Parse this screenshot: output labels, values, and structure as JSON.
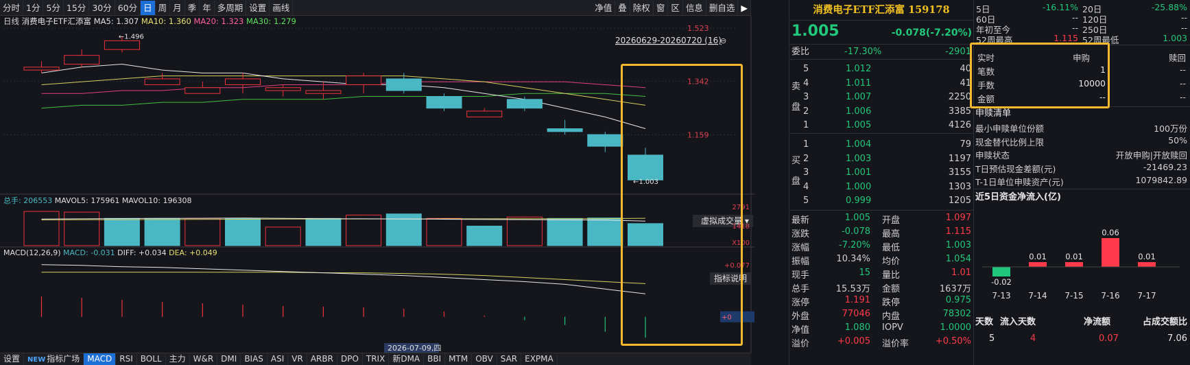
{
  "toolbar": {
    "periods": [
      "分时",
      "1分",
      "5分",
      "15分",
      "30分",
      "60分",
      "日",
      "周",
      "月",
      "季",
      "年",
      "多周期",
      "设置",
      "画线"
    ],
    "active_period": "日",
    "right_buttons": [
      "净值",
      "叠",
      "除权",
      "窗",
      "区",
      "信息",
      "删自选"
    ]
  },
  "kline_header": {
    "period": "日线",
    "name": "消费电子ETF汇添富",
    "ma5": "MA5: 1.307",
    "ma10": "MA10: 1.360",
    "ma20": "MA20: 1.323",
    "ma30": "MA30: 1.279",
    "range_label": "20260629-20260720 (16)",
    "price_axis": [
      "1.523",
      "1.342",
      "1.159"
    ],
    "high_note": "←1.496",
    "low_note": "←1.003"
  },
  "volume_header": {
    "total": "总手: 206553",
    "mavol5": "MAVOL5: 175961",
    "mavol10": "MAVOL10: 196308",
    "virtual_btn": "虚拟成交量",
    "axis": [
      "2791",
      "1418",
      "X100"
    ]
  },
  "macd_header": {
    "label": "MACD(12,26,9)",
    "macd": "MACD: -0.031",
    "diff": "DIFF: +0.034",
    "dea": "DEA: +0.049",
    "explain_btn": "指标说明",
    "axis_top": "+0.077",
    "axis_zero": "+0"
  },
  "date_marker": "2026-07-09,四",
  "chart_data": [
    {
      "type": "candlestick",
      "title": "消费电子ETF汇添富 日线",
      "x": [
        "2026-06-29",
        "2026-06-30",
        "2026-07-01",
        "2026-07-02",
        "2026-07-03",
        "2026-07-06",
        "2026-07-07",
        "2026-07-08",
        "2026-07-09",
        "2026-07-10",
        "2026-07-13",
        "2026-07-14",
        "2026-07-15",
        "2026-07-16",
        "2026-07-17",
        "2026-07-20"
      ],
      "open": [
        1.38,
        1.4,
        1.45,
        1.33,
        1.3,
        1.33,
        1.31,
        1.3,
        1.33,
        1.35,
        1.29,
        1.22,
        1.28,
        1.18,
        1.16,
        1.09
      ],
      "close": [
        1.39,
        1.43,
        1.48,
        1.35,
        1.32,
        1.35,
        1.32,
        1.31,
        1.36,
        1.31,
        1.25,
        1.24,
        1.25,
        1.17,
        1.12,
        1.005
      ],
      "high": [
        1.41,
        1.45,
        1.496,
        1.37,
        1.34,
        1.37,
        1.33,
        1.34,
        1.37,
        1.37,
        1.3,
        1.25,
        1.29,
        1.21,
        1.17,
        1.115
      ],
      "low": [
        1.37,
        1.39,
        1.44,
        1.33,
        1.3,
        1.3,
        1.29,
        1.28,
        1.3,
        1.3,
        1.24,
        1.22,
        1.24,
        1.16,
        1.1,
        1.003
      ],
      "ma5": [
        1.37,
        1.39,
        1.4,
        1.38,
        1.37,
        1.37,
        1.35,
        1.34,
        1.33,
        1.33,
        1.32,
        1.3,
        1.28,
        1.25,
        1.22,
        1.18
      ],
      "ma10": [
        1.33,
        1.34,
        1.35,
        1.36,
        1.36,
        1.36,
        1.36,
        1.36,
        1.36,
        1.36,
        1.35,
        1.34,
        1.32,
        1.3,
        1.28,
        1.26
      ],
      "ma20": [
        1.3,
        1.3,
        1.31,
        1.31,
        1.32,
        1.32,
        1.33,
        1.33,
        1.33,
        1.34,
        1.34,
        1.34,
        1.34,
        1.34,
        1.33,
        1.32
      ],
      "ma30": [
        1.25,
        1.26,
        1.26,
        1.27,
        1.27,
        1.28,
        1.28,
        1.28,
        1.29,
        1.29,
        1.29,
        1.29,
        1.3,
        1.3,
        1.3,
        1.29
      ],
      "ylim": [
        0.98,
        1.53
      ]
    },
    {
      "type": "bar",
      "title": "volume",
      "values": [
        2450,
        2400,
        1950,
        1950,
        1950,
        1950,
        1330,
        1950,
        2190,
        2270,
        1950,
        1400,
        2050,
        1950,
        1980,
        1580
      ],
      "up": [
        true,
        true,
        false,
        false,
        true,
        false,
        true,
        false,
        true,
        false,
        true,
        false,
        true,
        false,
        false,
        false
      ],
      "mavol5": [
        1900,
        1920,
        1940,
        1950,
        1960,
        1980,
        1950,
        1930,
        1920,
        1910,
        1890,
        1870,
        1860,
        1840,
        1830,
        1760
      ],
      "mavol10": [
        1840,
        1850,
        1860,
        1870,
        1880,
        1890,
        1900,
        1900,
        1910,
        1910,
        1920,
        1920,
        1920,
        1930,
        1930,
        1960
      ],
      "ylim": [
        0,
        2800
      ]
    },
    {
      "type": "bar",
      "title": "MACD",
      "values": [
        0.03,
        0.028,
        0.025,
        0.022,
        0.02,
        0.018,
        0.016,
        0.015,
        0.014,
        0.012,
        0.008,
        0.002,
        -0.005,
        -0.012,
        -0.022,
        -0.031
      ],
      "diff": [
        0.077,
        0.076,
        0.074,
        0.073,
        0.071,
        0.069,
        0.067,
        0.065,
        0.063,
        0.061,
        0.058,
        0.055,
        0.052,
        0.048,
        0.041,
        0.034
      ],
      "dea": [
        0.066,
        0.066,
        0.066,
        0.066,
        0.066,
        0.066,
        0.066,
        0.065,
        0.065,
        0.064,
        0.063,
        0.061,
        0.058,
        0.055,
        0.052,
        0.049
      ],
      "ylim": [
        -0.05,
        0.09
      ]
    }
  ],
  "bottom_tabs": [
    "设置",
    "指标广场",
    "MACD",
    "RSI",
    "BOLL",
    "主力",
    "W&R",
    "DMI",
    "BIAS",
    "ASI",
    "VR",
    "ARBR",
    "DPO",
    "TRIX",
    "新DMA",
    "BBI",
    "MTM",
    "OBV",
    "SAR",
    "EXPMA"
  ],
  "bottom_new_tag": "NEW",
  "bottom_active": "MACD",
  "quote": {
    "title": "消费电子ETF汇添富 159178",
    "price": "1.005",
    "change": "-0.078(-7.20%)",
    "weibi_label": "委比",
    "weibi_val": "-17.30%",
    "weibi_diff": "-2901",
    "sell_label": [
      "卖",
      "盘"
    ],
    "buy_label": [
      "买",
      "盘"
    ],
    "asks": [
      {
        "lvl": "5",
        "price": "1.012",
        "vol": "40"
      },
      {
        "lvl": "4",
        "price": "1.011",
        "vol": "41"
      },
      {
        "lvl": "3",
        "price": "1.007",
        "vol": "2250"
      },
      {
        "lvl": "2",
        "price": "1.006",
        "vol": "3385"
      },
      {
        "lvl": "1",
        "price": "1.005",
        "vol": "4126"
      }
    ],
    "bids": [
      {
        "lvl": "1",
        "price": "1.004",
        "vol": "79"
      },
      {
        "lvl": "2",
        "price": "1.003",
        "vol": "1197"
      },
      {
        "lvl": "3",
        "price": "1.001",
        "vol": "3155"
      },
      {
        "lvl": "4",
        "price": "1.000",
        "vol": "1303"
      },
      {
        "lvl": "5",
        "price": "0.999",
        "vol": "1205"
      }
    ],
    "stats": [
      {
        "l1": "最新",
        "v1": "1.005",
        "c1": "green",
        "l2": "开盘",
        "v2": "1.097",
        "c2": "red"
      },
      {
        "l1": "涨跌",
        "v1": "-0.078",
        "c1": "green",
        "l2": "最高",
        "v2": "1.115",
        "c2": "red"
      },
      {
        "l1": "涨幅",
        "v1": "-7.20%",
        "c1": "green",
        "l2": "最低",
        "v2": "1.003",
        "c2": "green"
      },
      {
        "l1": "振幅",
        "v1": "10.34%",
        "c1": "gray",
        "l2": "均价",
        "v2": "1.054",
        "c2": "green"
      },
      {
        "l1": "现手",
        "v1": "15",
        "c1": "green",
        "l2": "量比",
        "v2": "1.01",
        "c2": "red"
      },
      {
        "l1": "总手",
        "v1": "15.53万",
        "c1": "gray",
        "l2": "金额",
        "v2": "1637万",
        "c2": "gray"
      },
      {
        "l1": "涨停",
        "v1": "1.191",
        "c1": "red",
        "l2": "跌停",
        "v2": "0.975",
        "c2": "green"
      },
      {
        "l1": "外盘",
        "v1": "77046",
        "c1": "red",
        "l2": "内盘",
        "v2": "78302",
        "c2": "green"
      },
      {
        "l1": "净值",
        "v1": "1.080",
        "c1": "green",
        "l2": "IOPV",
        "v2": "1.0000",
        "c2": "green"
      },
      {
        "l1": "溢价",
        "v1": "+0.005",
        "c1": "red",
        "l2": "溢价率",
        "v2": "+0.50%",
        "c2": "red"
      }
    ]
  },
  "etf": {
    "perf": [
      {
        "l1": "5日",
        "v1": "-16.11%",
        "l2": "20日",
        "v2": "-25.88%"
      },
      {
        "l1": "60日",
        "v1": "-- ",
        "l2": "120日",
        "v2": "--"
      },
      {
        "l1": "年初至今",
        "v1": "-- ",
        "l2": "250日",
        "v2": "--"
      },
      {
        "l1": "52周最高",
        "v1": "1.115",
        "l2": "52周最低",
        "v2": "1.003"
      }
    ],
    "sub_header": {
      "c1": "实时",
      "c2": "申购",
      "c3": "赎回"
    },
    "sub_rows": [
      {
        "l": "笔数",
        "v": "1",
        "r": "--"
      },
      {
        "l": "手数",
        "v": "10000",
        "r": "--"
      },
      {
        "l": "金额",
        "v": "--",
        "r": "--"
      }
    ],
    "list_title": "申赎清单",
    "list": [
      {
        "l": "最小申赎单位份额",
        "v": "100万份"
      },
      {
        "l": "现金替代比例上限",
        "v": "50%"
      },
      {
        "l": "申赎状态",
        "v": "开放申购|开放赎回"
      },
      {
        "l": "T日预估现金差额(元)",
        "v": "-21469.23"
      },
      {
        "l": "T-1日单位申赎资产(元)",
        "v": "1079842.89"
      }
    ],
    "flow_title": "近5日资金净流入(亿)",
    "flow_chart": {
      "type": "bar",
      "categories": [
        "7-13",
        "7-14",
        "7-15",
        "7-16",
        "7-17"
      ],
      "values": [
        -0.02,
        0.01,
        0.01,
        0.06,
        0.01
      ],
      "labels": [
        "-0.02",
        "0.01",
        "0.01",
        "0.06",
        "0.01"
      ]
    },
    "summary_header": [
      "天数",
      "流入天数",
      "净流额",
      "占成交额比"
    ],
    "summary_values": [
      "5",
      "4",
      "0.07",
      "7.06"
    ]
  }
}
